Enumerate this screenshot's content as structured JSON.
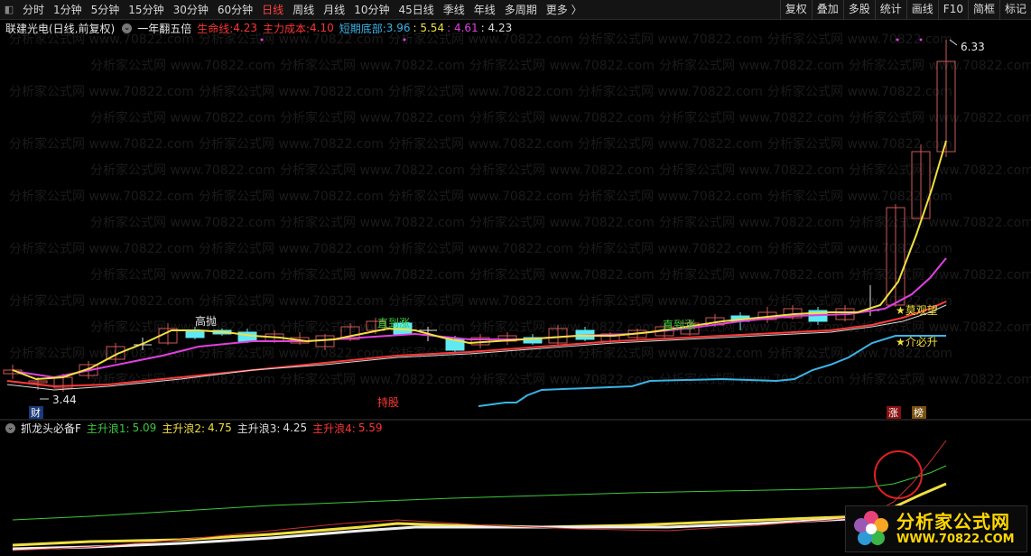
{
  "toolbar": {
    "left_icon": "panel-toggle-icon",
    "periods": [
      "分时",
      "1分钟",
      "5分钟",
      "15分钟",
      "30分钟",
      "60分钟",
      "日线",
      "周线",
      "月线",
      "10分钟",
      "45日线",
      "季线",
      "年线",
      "多周期",
      "更多 〉"
    ],
    "active_period": "日线",
    "right_buttons": [
      "复权",
      "叠加",
      "多股",
      "统计",
      "画线",
      "F10",
      "简框",
      "标记"
    ]
  },
  "info": {
    "stock": "联建光电(日线,前复权)",
    "indicator": "一年翻五倍",
    "lifeline_label": "生命线:",
    "lifeline_value": "4.23",
    "cost_label": "主力成本:",
    "cost_value": "4.10",
    "bottom_label": "短期底部:",
    "bottom_value": "3.96",
    "v1": "5.54",
    "v2": "4.61",
    "v3": "4.23",
    "colors": {
      "lifeline": "#ff3333",
      "cost": "#ff3333",
      "bottom": "#3ab4e6",
      "v1": "#f0e040",
      "v2": "#e040e0",
      "v3": "#dddddd"
    }
  },
  "chart_labels": {
    "high": "6.33",
    "low": "3.44",
    "gaopao": "高抛",
    "zhidao1": "直到涨",
    "zhidao2": "直到涨",
    "chigu": "持股",
    "moguan": "★莫观望",
    "jiebisheng": "★介必升",
    "cai": "财",
    "zhang": "涨",
    "bang": "榜"
  },
  "sub": {
    "indicator": "抓龙头必备F",
    "w1_label": "主升浪1:",
    "w1_value": "5.09",
    "w2_label": "主升浪2:",
    "w2_value": "4.75",
    "w3_label": "主升浪3:",
    "w3_value": "4.25",
    "w4_label": "主升浪4:",
    "w4_value": "5.59",
    "colors": {
      "w1": "#3cc83c",
      "w2": "#f0e040",
      "w3": "#dddddd",
      "w4": "#ff3333"
    }
  },
  "watermark": {
    "line1": "分析家公式网",
    "line2": "WWW.70822.COM"
  }
}
